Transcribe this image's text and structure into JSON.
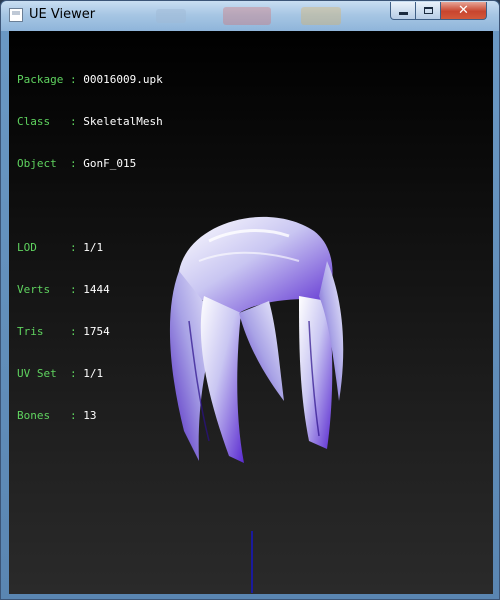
{
  "window": {
    "title": "UE Viewer",
    "controls": {
      "minimize": "minimize",
      "maximize": "maximize",
      "close": "✕"
    }
  },
  "info": [
    {
      "key": "Package",
      "sep": " : ",
      "value": "00016009.upk"
    },
    {
      "key": "Class  ",
      "sep": " : ",
      "value": "SkeletalMesh"
    },
    {
      "key": "Object ",
      "sep": " : ",
      "value": "GonF_015"
    },
    {
      "key": "",
      "sep": "",
      "value": ""
    },
    {
      "key": "LOD    ",
      "sep": " : ",
      "value": "1/1"
    },
    {
      "key": "Verts  ",
      "sep": " : ",
      "value": "1444"
    },
    {
      "key": "Tris   ",
      "sep": " : ",
      "value": "1754"
    },
    {
      "key": "UV Set ",
      "sep": " : ",
      "value": "1/1"
    },
    {
      "key": "Bones  ",
      "sep": " : ",
      "value": "13"
    }
  ],
  "colors": {
    "label": "#5fd35f",
    "value": "#ffffff",
    "hair_light": "#eef0ff",
    "hair_dark": "#5a2ad0",
    "axis": "#1a1a9c"
  }
}
